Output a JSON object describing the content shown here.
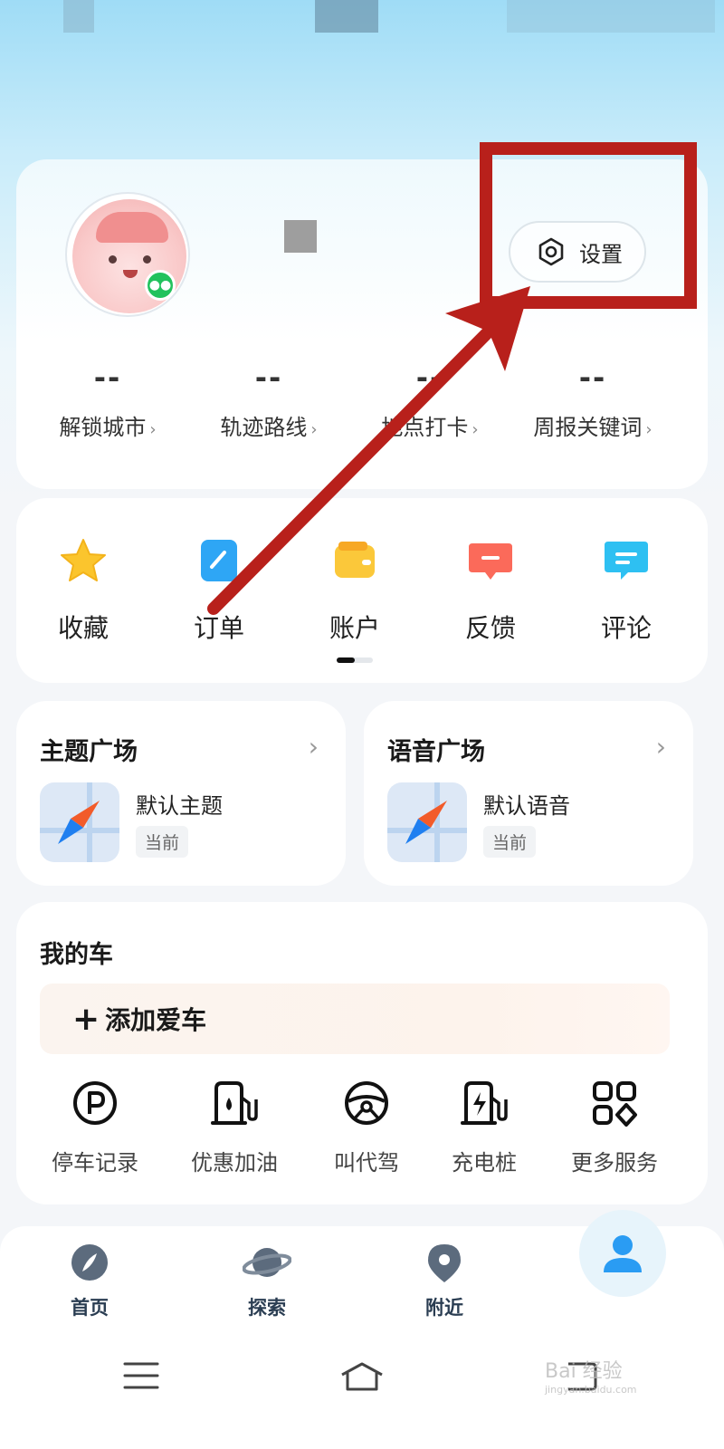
{
  "profile": {
    "settings_label": "设置",
    "stats": [
      {
        "value": "--",
        "label": "解锁城市"
      },
      {
        "value": "--",
        "label": "轨迹路线"
      },
      {
        "value": "--",
        "label": "地点打卡"
      },
      {
        "value": "--",
        "label": "周报关键词"
      }
    ]
  },
  "quick_actions": [
    {
      "label": "收藏",
      "icon": "star-icon"
    },
    {
      "label": "订单",
      "icon": "order-icon"
    },
    {
      "label": "账户",
      "icon": "wallet-icon"
    },
    {
      "label": "反馈",
      "icon": "feedback-icon"
    },
    {
      "label": "评论",
      "icon": "comment-icon"
    }
  ],
  "theme_square": {
    "title": "主题广场",
    "item": "默认主题",
    "tag": "当前"
  },
  "voice_square": {
    "title": "语音广场",
    "item": "默认语音",
    "tag": "当前"
  },
  "my_car": {
    "title": "我的车",
    "add_label": "添加爱车",
    "services": [
      {
        "label": "停车记录",
        "icon": "parking-icon"
      },
      {
        "label": "优惠加油",
        "icon": "fuel-icon"
      },
      {
        "label": "叫代驾",
        "icon": "steering-wheel-icon"
      },
      {
        "label": "充电桩",
        "icon": "charging-pile-icon"
      },
      {
        "label": "更多服务",
        "icon": "more-services-icon"
      }
    ]
  },
  "bottom_nav": [
    {
      "label": "首页",
      "icon": "home-compass-icon"
    },
    {
      "label": "探索",
      "icon": "planet-icon"
    },
    {
      "label": "附近",
      "icon": "location-pin-icon"
    },
    {
      "label": "",
      "icon": "user-icon",
      "active": true
    }
  ],
  "watermark": {
    "text": "Bai 经验",
    "sub": "jingyan.baidu.com"
  },
  "colors": {
    "accent_red": "#b8201b",
    "brand_blue": "#2a8cff"
  }
}
